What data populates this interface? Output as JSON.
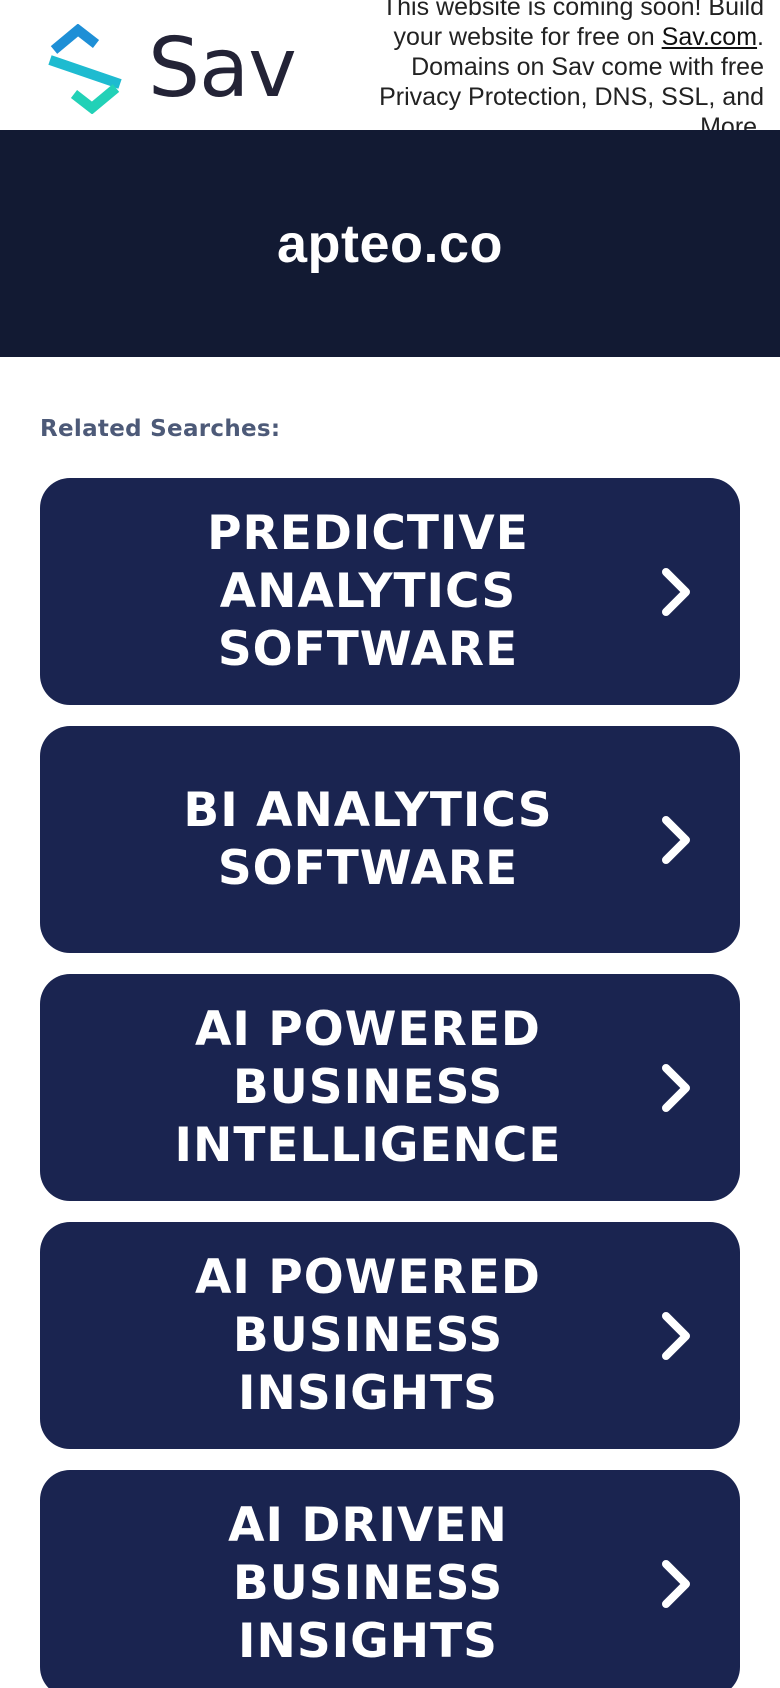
{
  "header": {
    "brand": "Sav",
    "notice_before": "This website is coming soon! Build your website for free on ",
    "notice_link": "Sav.com",
    "notice_after": ". Domains on Sav come with free Privacy Protection, DNS, SSL, and More."
  },
  "hero": {
    "domain": "apteo.co"
  },
  "related": {
    "heading": "Related Searches:",
    "items": [
      {
        "label": "PREDICTIVE ANALYTICS SOFTWARE",
        "icon": "chevron-right-icon"
      },
      {
        "label": "BI ANALYTICS SOFTWARE",
        "icon": "chevron-right-icon"
      },
      {
        "label": "AI POWERED BUSINESS INTELLIGENCE",
        "icon": "chevron-right-icon"
      },
      {
        "label": "AI POWERED BUSINESS INSIGHTS",
        "icon": "chevron-right-icon"
      },
      {
        "label": "AI DRIVEN BUSINESS INSIGHTS",
        "icon": "chevron-right-icon"
      }
    ]
  },
  "colors": {
    "hero_bg": "#121a33",
    "button_bg": "#1a2450",
    "logo_blue": "#1e8fd6",
    "logo_teal": "#22d1b7",
    "brand_text": "#232336"
  }
}
